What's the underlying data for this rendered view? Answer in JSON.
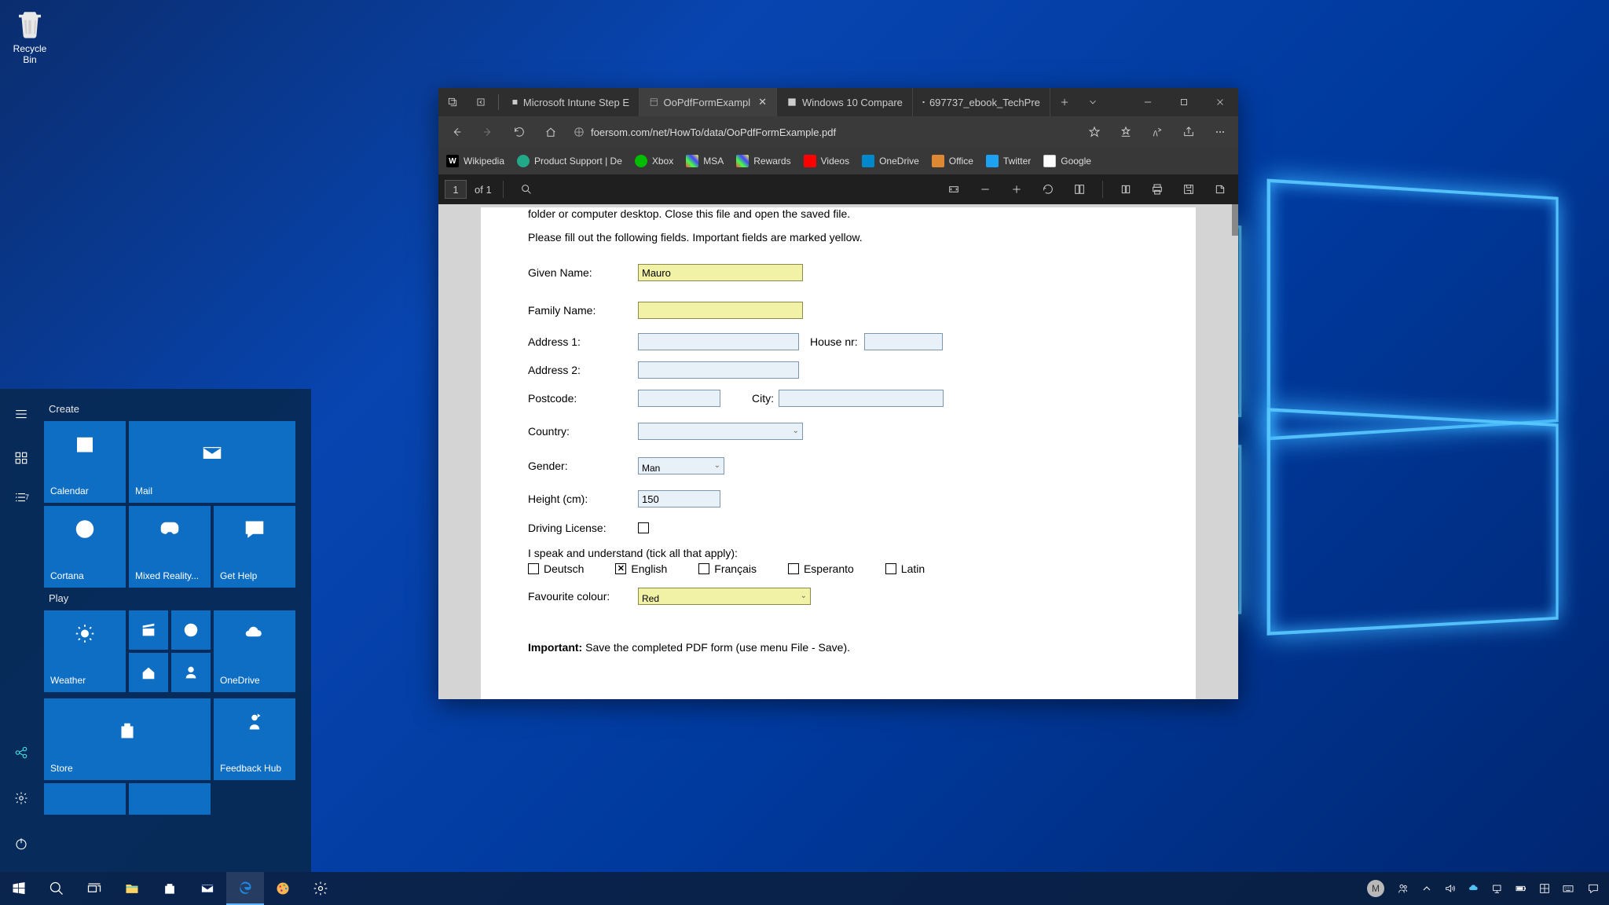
{
  "desktop": {
    "recycle_bin": "Recycle Bin"
  },
  "start_menu": {
    "sections": {
      "create": "Create",
      "play": "Play"
    },
    "tiles": {
      "calendar": "Calendar",
      "mail": "Mail",
      "cortana": "Cortana",
      "mixed_reality": "Mixed Reality...",
      "get_help": "Get Help",
      "weather": "Weather",
      "onedrive": "OneDrive",
      "store": "Store",
      "feedback_hub": "Feedback Hub"
    }
  },
  "taskbar": {
    "user_initial": "M"
  },
  "browser": {
    "tabs": [
      {
        "label": "Microsoft Intune Step E"
      },
      {
        "label": "OoPdfFormExampl"
      },
      {
        "label": "Windows 10 Compare"
      },
      {
        "label": "697737_ebook_TechPre"
      }
    ],
    "url": "foersom.com/net/HowTo/data/OoPdfFormExample.pdf",
    "bookmarks": [
      "Wikipedia",
      "Product Support | De",
      "Xbox",
      "MSA",
      "Rewards",
      "Videos",
      "OneDrive",
      "Office",
      "Twitter",
      "Google"
    ],
    "pdfbar": {
      "page": "1",
      "of": "of 1"
    }
  },
  "pdf": {
    "intro1": "folder or computer desktop. Close this file and open the saved file.",
    "intro2": "Please fill out the following fields. Important fields are marked yellow.",
    "labels": {
      "given_name": "Given Name:",
      "family_name": "Family Name:",
      "address1": "Address 1:",
      "address2": "Address 2:",
      "house_nr": "House nr:",
      "postcode": "Postcode:",
      "city": "City:",
      "country": "Country:",
      "gender": "Gender:",
      "height": "Height (cm):",
      "driving": "Driving License:",
      "languages_intro": "I speak and understand (tick all that apply):",
      "fav_colour": "Favourite colour:",
      "important_label": "Important:",
      "important_text": " Save the completed PDF form (use menu File - Save)."
    },
    "values": {
      "given_name": "Mauro",
      "family_name": "",
      "address1": "",
      "address2": "",
      "house_nr": "",
      "postcode": "",
      "city": "",
      "country": "",
      "gender": "Man",
      "height": "150",
      "fav_colour": "Red"
    },
    "languages": {
      "deutsch": "Deutsch",
      "english": "English",
      "francais": "Français",
      "esperanto": "Esperanto",
      "latin": "Latin",
      "checked": {
        "english": true
      }
    }
  }
}
